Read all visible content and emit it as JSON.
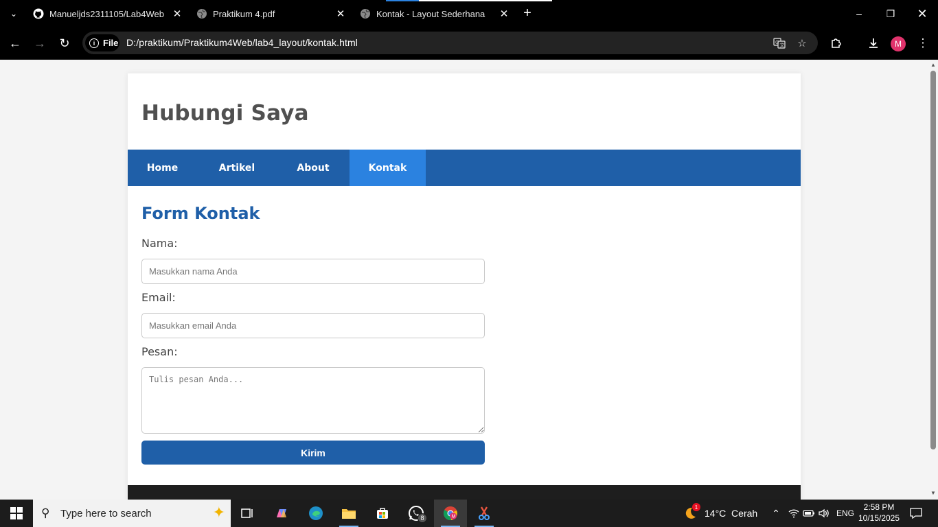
{
  "browser": {
    "tabs": [
      {
        "title": "Manueljds2311105/Lab4Web",
        "icon": "github-icon"
      },
      {
        "title": "Praktikum 4.pdf",
        "icon": "globe-icon"
      },
      {
        "title": "Kontak - Layout Sederhana",
        "icon": "globe-icon"
      }
    ],
    "scheme_chip": "File",
    "url": "D:/praktikum/Praktikum4Web/lab4_layout/kontak.html",
    "profile_initial": "M"
  },
  "page": {
    "header_title": "Hubungi Saya",
    "nav": [
      {
        "label": "Home"
      },
      {
        "label": "Artikel"
      },
      {
        "label": "About"
      },
      {
        "label": "Kontak",
        "active": true
      }
    ],
    "form_title": "Form Kontak",
    "name_label": "Nama:",
    "name_placeholder": "Masukkan nama Anda",
    "email_label": "Email:",
    "email_placeholder": "Masukkan email Anda",
    "message_label": "Pesan:",
    "message_placeholder": "Tulis pesan Anda...",
    "submit_label": "Kirim"
  },
  "taskbar": {
    "search_placeholder": "Type here to search",
    "whatsapp_badge": "8",
    "weather_badge": "1",
    "weather": "14°C  Cerah",
    "language": "ENG",
    "time": "2:58 PM",
    "date": "10/15/2025"
  },
  "colors": {
    "nav_bg": "#1f5fa8",
    "nav_active": "#2b82e0",
    "title_blue": "#1f5fa8",
    "header_text": "#505050"
  }
}
